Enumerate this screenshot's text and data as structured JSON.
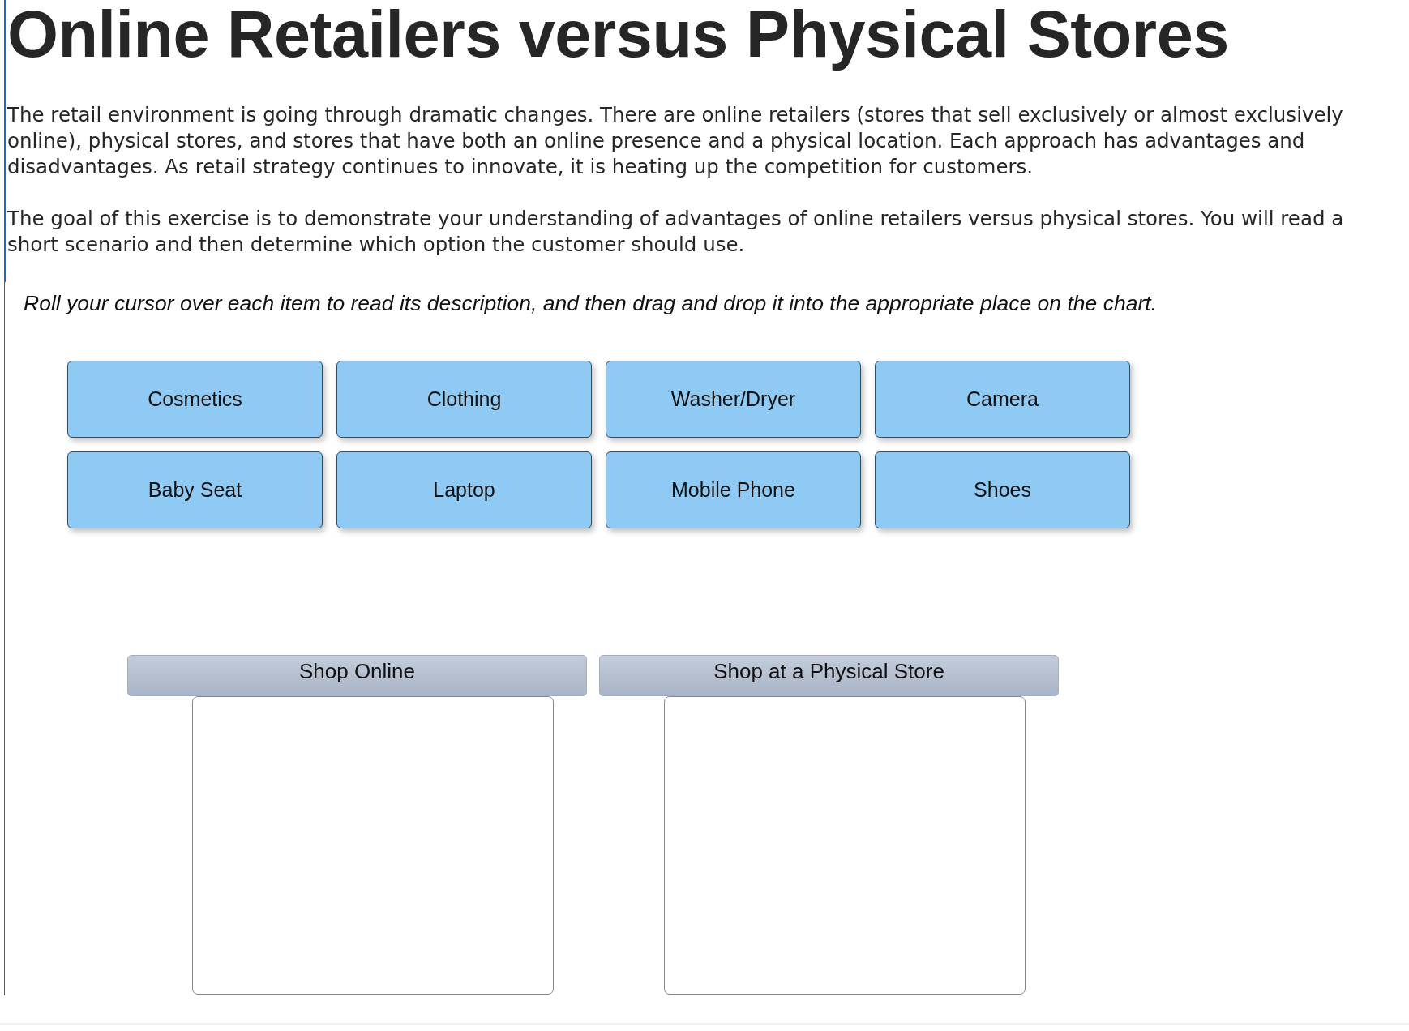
{
  "title": "Online Retailers versus Physical Stores",
  "paragraphs": [
    "The retail environment is going through dramatic changes. There are online retailers (stores that sell exclusively or almost exclusively online), physical stores, and stores that have both an online presence and a physical location. Each approach has advantages and disadvantages. As retail strategy continues to innovate, it is heating up the competition for customers.",
    "The goal of this exercise is to demonstrate your understanding of advantages of online retailers versus physical stores. You will read a short scenario and then determine which option the customer should use."
  ],
  "instruction": "Roll your cursor over each item to read its description, and then drag and drop it into the appropriate place on the chart.",
  "items": [
    "Cosmetics",
    "Clothing",
    "Washer/Dryer",
    "Camera",
    "Baby Seat",
    "Laptop",
    "Mobile Phone",
    "Shoes"
  ],
  "categories": [
    {
      "label": "Shop Online"
    },
    {
      "label": "Shop at a Physical Store"
    }
  ]
}
